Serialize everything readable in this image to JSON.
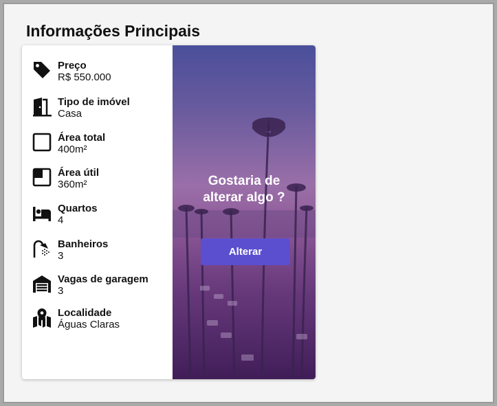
{
  "page": {
    "title": "Informações Principais"
  },
  "info": [
    {
      "icon": "price-tag-icon",
      "label": "Preço",
      "value": "R$ 550.000"
    },
    {
      "icon": "door-icon",
      "label": "Tipo de imóvel",
      "value": "Casa"
    },
    {
      "icon": "square-outline-icon",
      "label": "Área total",
      "value": "400m²"
    },
    {
      "icon": "square-filled-corner-icon",
      "label": "Área útil",
      "value": "360m²"
    },
    {
      "icon": "bed-icon",
      "label": "Quartos",
      "value": "4"
    },
    {
      "icon": "shower-icon",
      "label": "Banheiros",
      "value": "3"
    },
    {
      "icon": "garage-icon",
      "label": "Vagas de garagem",
      "value": "3"
    },
    {
      "icon": "map-location-icon",
      "label": "Localidade",
      "value": "Águas Claras"
    }
  ],
  "promo": {
    "title_line1": "Gostaria de",
    "title_line2": "alterar algo ?",
    "button_label": "Alterar"
  },
  "colors": {
    "button": "#5b4fd0",
    "promo_gradient_top": "#4a4f9a",
    "promo_gradient_bottom": "#5a2a70"
  }
}
